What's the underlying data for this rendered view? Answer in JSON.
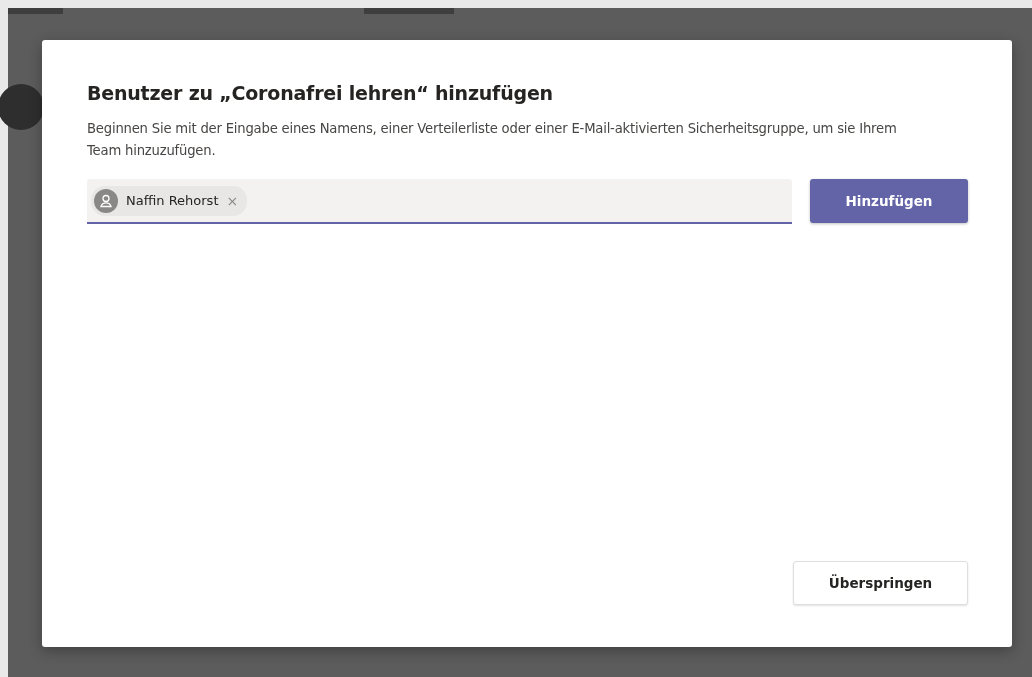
{
  "dialog": {
    "title": "Benutzer zu „Coronafrei lehren“ hinzufügen",
    "description": "Beginnen Sie mit der Eingabe eines Namens, einer Verteilerliste oder einer E-Mail-aktivierten Sicherheitsgruppe, um sie Ihrem Team hinzuzufügen.",
    "people_field": {
      "chips": [
        {
          "name": "Naffin Rehorst",
          "remove": "×"
        }
      ]
    },
    "add_button": "Hinzufügen",
    "skip_button": "Überspringen"
  }
}
